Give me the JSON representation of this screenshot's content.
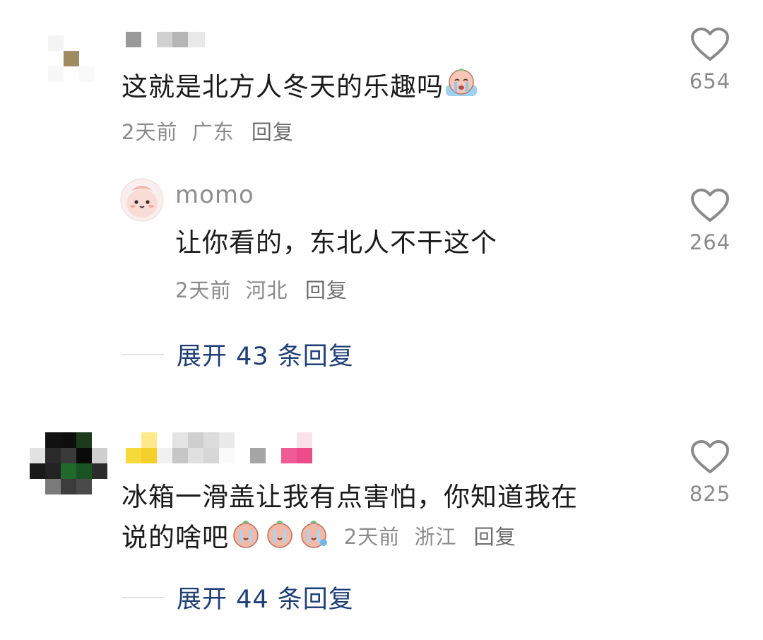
{
  "comments": [
    {
      "text": "这就是北方人冬天的乐趣吗",
      "emoji": "crying-face-emoji",
      "time": "2天前",
      "location": "广东",
      "reply_label": "回复",
      "likes": "654",
      "replies": [
        {
          "username": "momo",
          "text": "让你看的，东北人不干这个",
          "time": "2天前",
          "location": "河北",
          "reply_label": "回复",
          "likes": "264"
        }
      ],
      "expand_label": "展开 43 条回复"
    },
    {
      "text_line1": "冰箱一滑盖让我有点害怕，你知道我在",
      "text_line2": "说的啥吧",
      "emojis": [
        "sweating-face-emoji",
        "sweating-face-emoji",
        "sweating-face-emoji"
      ],
      "time": "2天前",
      "location": "浙江",
      "reply_label": "回复",
      "likes": "825",
      "expand_label": "展开 44 条回复"
    }
  ],
  "colors": {
    "text": "#1b1b1b",
    "meta": "#8b8b8b",
    "link": "#1f3f75",
    "heart": "#8a8a8a"
  }
}
